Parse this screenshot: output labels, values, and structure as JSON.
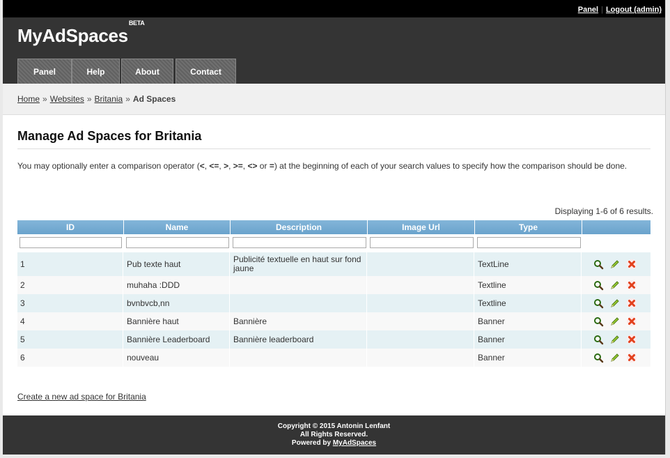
{
  "topbar": {
    "panel_link": "Panel",
    "logout_link": "Logout (admin)"
  },
  "header": {
    "logo": "MyAdSpaces",
    "logo_badge": "BETA",
    "nav": [
      "Panel",
      "Help",
      "About",
      "Contact"
    ]
  },
  "breadcrumb": {
    "home": "Home",
    "websites": "Websites",
    "site": "Britania",
    "current": "Ad Spaces",
    "separator": "»"
  },
  "page": {
    "title": "Manage Ad Spaces for Britania",
    "intro_prefix": "You may optionally enter a comparison operator (",
    "ops": [
      "<",
      "<=",
      ">",
      ">=",
      "<>",
      "="
    ],
    "intro_suffix": ") at the beginning of each of your search values to specify how the comparison should be done.",
    "summary": "Displaying 1-6 of 6 results.",
    "create_link": "Create a new ad space for Britania"
  },
  "grid": {
    "columns": [
      "ID",
      "Name",
      "Description",
      "Image Url",
      "Type"
    ],
    "rows": [
      {
        "id": "1",
        "name": "Pub texte haut",
        "description": "Publicité textuelle en haut sur fond jaune",
        "image_url": "",
        "type": "TextLine"
      },
      {
        "id": "2",
        "name": "muhaha :DDD",
        "description": "",
        "image_url": "",
        "type": "Textline"
      },
      {
        "id": "3",
        "name": "bvnbvcb,nn",
        "description": "",
        "image_url": "",
        "type": "Textline"
      },
      {
        "id": "4",
        "name": "Bannière haut",
        "description": "Bannière",
        "image_url": "",
        "type": "Banner"
      },
      {
        "id": "5",
        "name": "Bannière Leaderboard",
        "description": "Bannière leaderboard",
        "image_url": "",
        "type": "Banner"
      },
      {
        "id": "6",
        "name": "nouveau",
        "description": "",
        "image_url": "",
        "type": "Banner"
      }
    ],
    "row_action_icons": [
      "view-icon",
      "edit-icon",
      "delete-icon"
    ]
  },
  "footer": {
    "copyright": "Copyright © 2015 Antonin Lenfant",
    "rights": "All Rights Reserved.",
    "powered_prefix": "Powered by ",
    "powered_link": "MyAdSpaces"
  },
  "colors": {
    "header_bg": "#343434",
    "grid_header": "#75aad2",
    "row_odd": "#e5f1f4",
    "row_even": "#f8f8f8"
  }
}
